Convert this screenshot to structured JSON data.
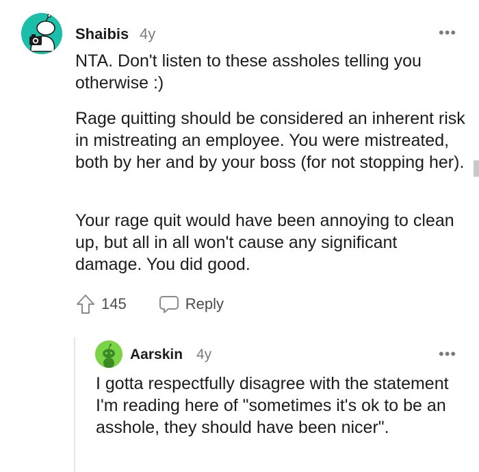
{
  "comments": [
    {
      "username": "Shaibis",
      "age": "4y",
      "more_label": "•••",
      "paragraphs": [
        "NTA. Don't listen to these assholes telling you otherwise :)",
        "Rage quitting should be considered an inherent risk in mistreating an employee. You were mistreated, both by her and by your boss (for not stopping her).",
        "Your rage quit would have been annoying to clean up, but all in all won't cause any significant damage. You did good."
      ],
      "votes": "145",
      "reply_label": "Reply",
      "avatar_color": "#1bbfa9"
    },
    {
      "username": "Aarskin",
      "age": "4y",
      "more_label": "•••",
      "paragraphs": [
        "I gotta respectfully disagree with the statement I'm reading here of \"sometimes it's ok to be an asshole, they should have been nicer\"."
      ],
      "avatar_color": "#7bd346"
    }
  ],
  "icons": {
    "upvote": "upvote-arrow-icon",
    "reply": "speech-bubble-icon",
    "more": "more-options-icon"
  }
}
